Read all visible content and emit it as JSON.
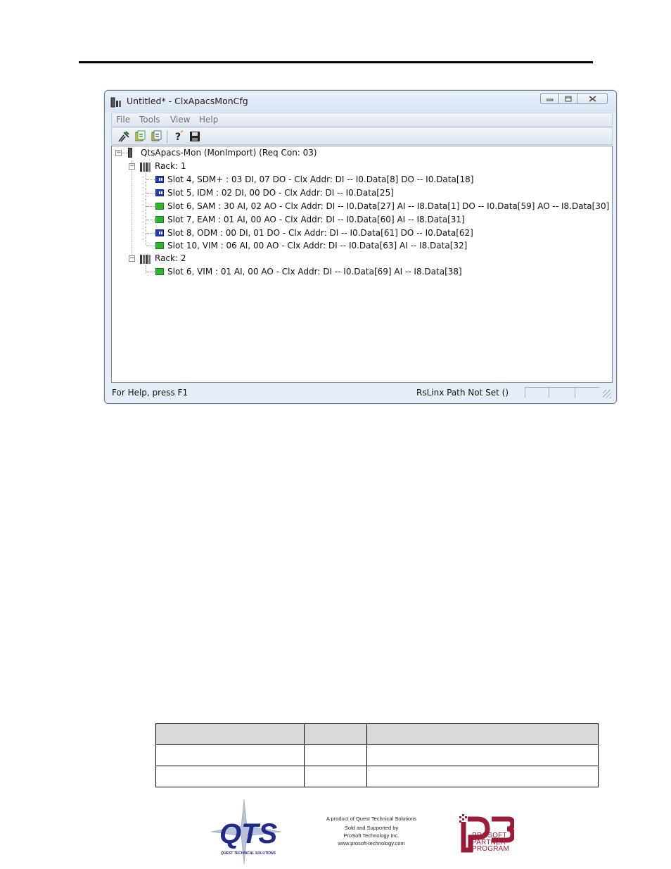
{
  "window": {
    "title": "Untitled* - ClxApacsMonCfg",
    "menu": [
      "File",
      "Tools",
      "View",
      "Help"
    ],
    "toolbar_icons": [
      "configure-icon",
      "download-icon",
      "upload-icon",
      "help-icon",
      "save-icon"
    ]
  },
  "tree": {
    "root": "QtsApacs-Mon (MonImport) (Req Con: 03)",
    "racks": [
      {
        "label": "Rack: 1",
        "slots": [
          {
            "label": "Slot 4, SDM+ : 03 DI, 07 DO - Clx Addr: DI -- I0.Data[8]  DO -- I0.Data[18]",
            "icon": "blue"
          },
          {
            "label": "Slot 5, IDM : 02 DI, 00 DO - Clx Addr: DI -- I0.Data[25]",
            "icon": "blue"
          },
          {
            "label": "Slot 6, SAM : 30 AI, 02 AO  - Clx Addr: DI -- I0.Data[27] AI -- I8.Data[1] DO -- I0.Data[59] AO -- I8.Data[30]",
            "icon": "green"
          },
          {
            "label": "Slot 7, EAM : 01 AI, 00 AO  - Clx Addr: DI -- I0.Data[60] AI -- I8.Data[31]",
            "icon": "green"
          },
          {
            "label": "Slot 8, ODM : 00 DI, 01 DO - Clx Addr: DI -- I0.Data[61]  DO -- I0.Data[62]",
            "icon": "blue"
          },
          {
            "label": "Slot 10, VIM : 06 AI, 00 AO  - Clx Addr: DI -- I0.Data[63] AI -- I8.Data[32]",
            "icon": "green"
          }
        ]
      },
      {
        "label": "Rack: 2",
        "slots": [
          {
            "label": "Slot 6, VIM : 01 AI, 00 AO  - Clx Addr: DI -- I0.Data[69] AI -- I8.Data[38]",
            "icon": "green"
          }
        ]
      }
    ]
  },
  "status": {
    "help": "For Help, press F1",
    "rslinx": "RsLinx Path Not Set ()"
  },
  "footer": {
    "lines": [
      "A product of Quest Technical Solutions",
      "Sold and Supported by",
      "ProSoft Technology Inc.",
      "www.prosoft-technology.com"
    ],
    "qts_logo_text": "QTS",
    "qts_logo_subtext": "QUEST TECHNICAL SOLUTIONS",
    "p3_logo_lines": [
      "PROSOFT",
      "PARTNER",
      "PROGRAM"
    ]
  }
}
